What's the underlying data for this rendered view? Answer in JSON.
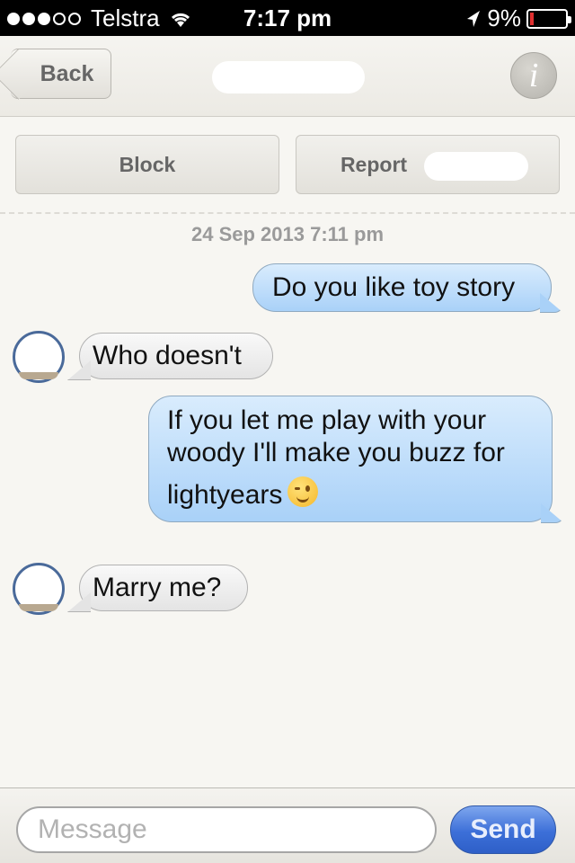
{
  "status_bar": {
    "carrier": "Telstra",
    "time": "7:17 pm",
    "battery": "9%",
    "signal_bars": 3,
    "signal_total": 5,
    "battery_level": 0.09
  },
  "nav": {
    "back_label": "Back",
    "info_label": "i"
  },
  "actions": {
    "block_label": "Block",
    "report_label": "Report"
  },
  "conversation": {
    "timestamp": "24 Sep 2013 7:11 pm",
    "messages": [
      {
        "direction": "out",
        "text": "Do you like toy story"
      },
      {
        "direction": "in",
        "text": "Who doesn't"
      },
      {
        "direction": "out",
        "line1": "If you let me play with your",
        "line2": "woody I'll make you buzz for",
        "line3": "lightyears",
        "emoji": "winking-face"
      },
      {
        "direction": "in",
        "text": "Marry me?"
      }
    ]
  },
  "composer": {
    "placeholder": "Message",
    "send_label": "Send"
  },
  "colors": {
    "outgoing_bubble": "#a9d1f8",
    "incoming_bubble": "#e4e4e4",
    "send_button": "#3c6fd8"
  }
}
